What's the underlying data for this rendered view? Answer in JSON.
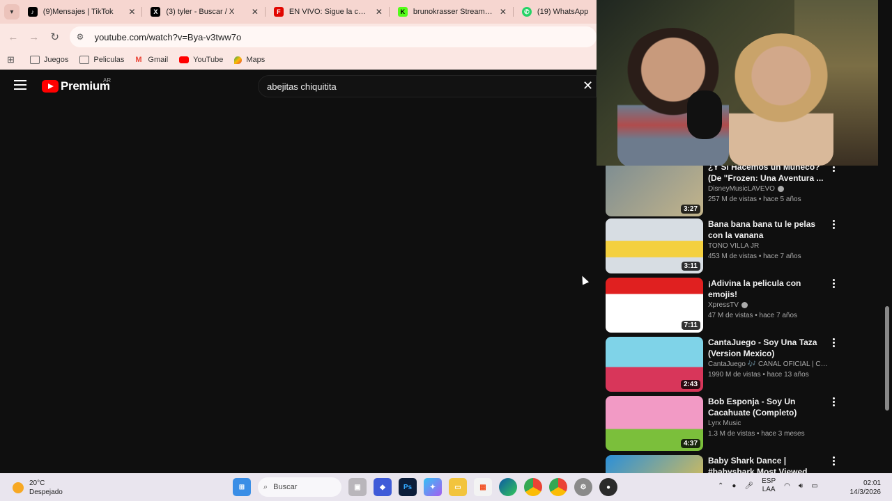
{
  "browser": {
    "tabs": [
      {
        "title": "(9)Mensajes | TikTok",
        "icon": "tiktok-icon",
        "color": "#000000"
      },
      {
        "title": "(3) tyler - Buscar / X",
        "icon": "x-icon",
        "color": "#000000"
      },
      {
        "title": "EN VIVO: Sigue la carrera S",
        "icon": "f1-icon",
        "color": "#e10600"
      },
      {
        "title": "brunokrasser Stream - Wat",
        "icon": "kick-icon",
        "color": "#53fc18"
      },
      {
        "title": "(19) WhatsApp",
        "icon": "whatsapp-icon",
        "color": "#25d366"
      }
    ],
    "url": "youtube.com/watch?v=Bya-v3tww7o",
    "bookmarks": [
      {
        "label": "Juegos",
        "icon": "folder-icon"
      },
      {
        "label": "Peliculas",
        "icon": "folder-icon"
      },
      {
        "label": "Gmail",
        "icon": "gmail-icon"
      },
      {
        "label": "YouTube",
        "icon": "youtube-icon"
      },
      {
        "label": "Maps",
        "icon": "maps-icon"
      }
    ]
  },
  "youtube": {
    "logo_text": "Premium",
    "region": "AR",
    "search_value": "abejitas chiquitita",
    "accent": "#ff0000",
    "related": [
      {
        "title": "¿Y Si Hacemos un Muñeco? (De \"Frozen: Una Aventura ...",
        "channel": "DisneyMusicLAVEVO",
        "verified": true,
        "stats": "257 M de vistas • hace 5 años",
        "duration": "3:27",
        "thumb_colors": [
          "#7d8d92",
          "#c3b48a"
        ]
      },
      {
        "title": "Bana bana bana tu le pelas con la vanana",
        "channel": "TOÑO VILLA JR",
        "verified": false,
        "stats": "453 M de vistas • hace 7 años",
        "duration": "3:11",
        "thumb_colors": [
          "#d7dde3",
          "#f4d03f"
        ]
      },
      {
        "title": "¡Adivina la pelicula con emojis!",
        "channel": "XpressTV",
        "verified": true,
        "stats": "47 M de vistas • hace 7 años",
        "duration": "7:11",
        "thumb_colors": [
          "#e02020",
          "#ffffff"
        ]
      },
      {
        "title": "CantaJuego - Soy Una Taza (Version Mexico)",
        "channel": "CantaJuego 🎶 CANAL OFICIAL | Canci...",
        "verified": false,
        "stats": "1990 M de vistas • hace 13 años",
        "duration": "2:43",
        "thumb_colors": [
          "#7fd3e8",
          "#d8365a"
        ]
      },
      {
        "title": "Bob Esponja - Soy Un Cacahuate (Completo) (Latino...",
        "channel": "Lyrx Music",
        "verified": false,
        "stats": "1.3 M de vistas • hace 3 meses",
        "duration": "4:37",
        "thumb_colors": [
          "#f29ac5",
          "#7bbf3b"
        ]
      },
      {
        "title": "Baby Shark Dance | #babyshark Most Viewed Video | Animal...",
        "channel": "",
        "verified": false,
        "stats": "",
        "duration": "",
        "thumb_colors": [
          "#2b8fd8",
          "#f5c542"
        ]
      }
    ]
  },
  "taskbar": {
    "temperature": "20°C",
    "weather": "Despejado",
    "search_placeholder": "Buscar",
    "lang_top": "ESP",
    "lang_bottom": "LAA",
    "time": "02:01",
    "date": "14/3/2026"
  }
}
